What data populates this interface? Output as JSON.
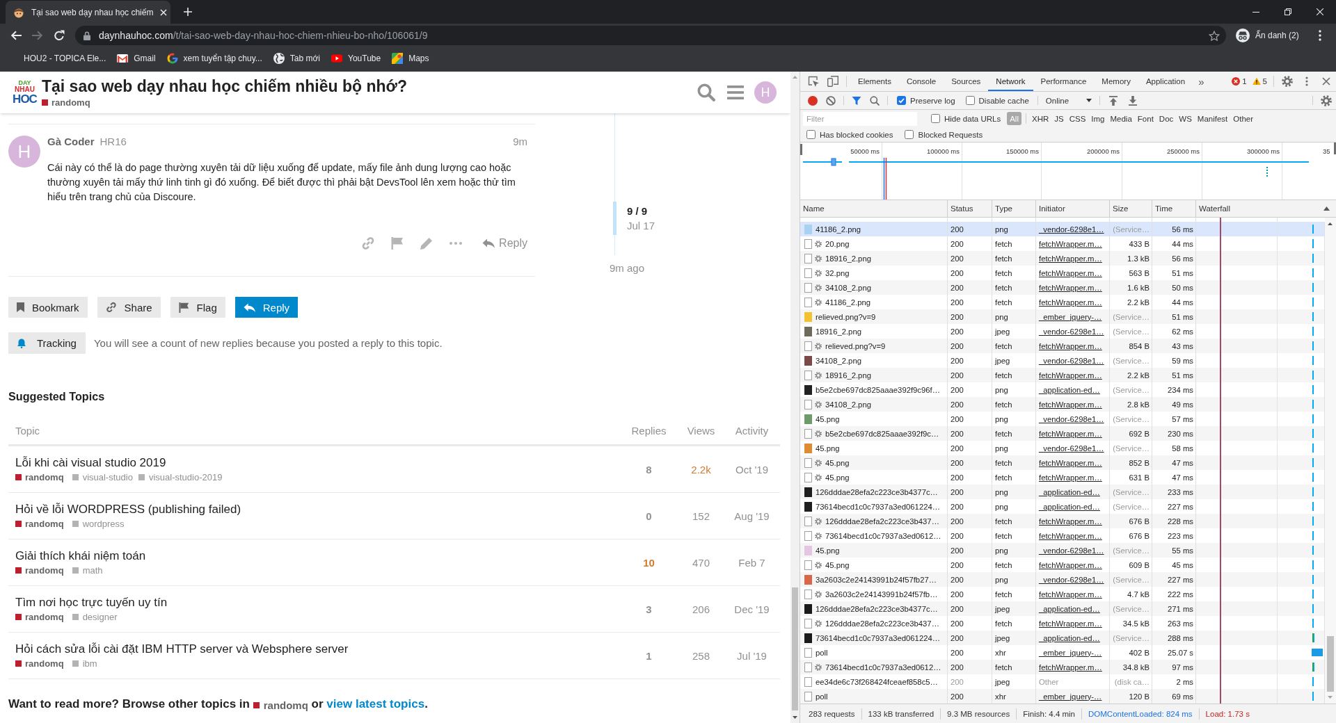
{
  "browser": {
    "tabs": [
      {
        "title": "Tại sao web dạy nhau học chiếm",
        "selected": true
      }
    ],
    "nav": [
      {
        "kind": "back",
        "disabled": false
      },
      {
        "kind": "forward",
        "disabled": true
      },
      {
        "kind": "reload",
        "disabled": false
      }
    ],
    "address": {
      "domain": "daynhauhoc.com",
      "path": "/t/tai-sao-web-day-nhau-hoc-chiem-nhieu-bo-nho/106061/9"
    },
    "profile": "Ẩn danh (2)",
    "bookmarks": [
      {
        "label": "HOU2 - TOPICA Ele...",
        "kind": "plain"
      },
      {
        "label": "Gmail",
        "kind": "mail"
      },
      {
        "label": "xem tuyển tập chuy...",
        "kind": "ring"
      },
      {
        "label": "Tab mới",
        "kind": "globe"
      },
      {
        "label": "YouTube",
        "kind": "play"
      },
      {
        "label": "Maps",
        "kind": "map"
      }
    ]
  },
  "page": {
    "header": {
      "logo": [
        "DAY",
        "NHAU",
        "HOC"
      ],
      "title": "Tại sao web dạy nhau học chiếm nhiều bộ nhớ?",
      "category": "randomq",
      "avatar": "H"
    },
    "post": {
      "avatar": "H",
      "author": "Gà Coder",
      "username": "HR16",
      "age": "9m",
      "body": "Cái này có thể là do page thường xuyên tải dữ liệu xuống để update, mấy file ảnh dung lượng cao hoặc thường xuyên tải mấy thứ linh tinh gì đó xuống. Để biết được thì phải bật DevsTool lên xem hoặc thử tìm hiểu trên trang chủ của Discoure.",
      "reply": "Reply"
    },
    "timeline": {
      "position": "9 / 9",
      "date": "Jul 17",
      "ago": "9m ago"
    },
    "actions": [
      {
        "label": "Bookmark",
        "kind": "bookmark",
        "primary": false
      },
      {
        "label": "Share",
        "kind": "share",
        "primary": false
      },
      {
        "label": "Flag",
        "kind": "flag",
        "primary": false
      },
      {
        "label": "Reply",
        "kind": "reply",
        "primary": true
      }
    ],
    "notification": {
      "label": "Tracking",
      "text": "You will see a count of new replies because you posted a reply to this topic."
    },
    "suggested": {
      "title": "Suggested Topics",
      "columns": [
        "Topic",
        "Replies",
        "Views",
        "Activity"
      ],
      "topics": [
        {
          "title": "Lỗi khi cài visual studio 2019",
          "category": "randomq",
          "tags": [
            "visual-studio",
            "visual-studio-2019"
          ],
          "replies": "8",
          "replies_hot": false,
          "views": "2.2k",
          "views_hot": true,
          "activity": "Oct '19"
        },
        {
          "title": "Hỏi về lỗi WORDPRESS (publishing failed)",
          "category": "randomq",
          "tags": [
            "wordpress"
          ],
          "replies": "0",
          "replies_hot": false,
          "views": "152",
          "views_hot": false,
          "activity": "Aug '19"
        },
        {
          "title": "Giải thích khái niệm toán",
          "category": "randomq",
          "tags": [
            "math"
          ],
          "replies": "10",
          "replies_hot": true,
          "views": "470",
          "views_hot": false,
          "activity": "Feb 7"
        },
        {
          "title": "Tìm nơi học trực tuyến uy tín",
          "category": "randomq",
          "tags": [
            "designer"
          ],
          "replies": "3",
          "replies_hot": false,
          "views": "206",
          "views_hot": false,
          "activity": "Dec '19"
        },
        {
          "title": "Hỏi cách sửa lỗi cài đặt IBM HTTP server và Websphere server",
          "category": "randomq",
          "tags": [
            "ibm"
          ],
          "replies": "1",
          "replies_hot": false,
          "views": "258",
          "views_hot": false,
          "activity": "Jul '19"
        }
      ]
    },
    "read_more": {
      "before": "Want to read more? Browse other topics in",
      "category": "randomq",
      "middle": "or",
      "link": "view latest topics",
      "after": "."
    }
  },
  "devtools": {
    "tabs": [
      {
        "label": "Elements",
        "selected": false
      },
      {
        "label": "Console",
        "selected": false
      },
      {
        "label": "Sources",
        "selected": false
      },
      {
        "label": "Network",
        "selected": true
      },
      {
        "label": "Performance",
        "selected": false
      },
      {
        "label": "Memory",
        "selected": false
      },
      {
        "label": "Application",
        "selected": false
      }
    ],
    "more": "»",
    "errors": "1",
    "warnings": "5",
    "recording": true,
    "preserve_log": {
      "label": "Preserve log",
      "checked": true
    },
    "disable_cache": {
      "label": "Disable cache",
      "checked": false
    },
    "throttling": "Online",
    "filter": {
      "placeholder": "Filter"
    },
    "hide_data_urls": {
      "label": "Hide data URLs",
      "checked": false
    },
    "types": [
      {
        "label": "All",
        "selected": true
      },
      {
        "label": "XHR",
        "selected": false
      },
      {
        "label": "JS",
        "selected": false
      },
      {
        "label": "CSS",
        "selected": false
      },
      {
        "label": "Img",
        "selected": false
      },
      {
        "label": "Media",
        "selected": false
      },
      {
        "label": "Font",
        "selected": false
      },
      {
        "label": "Doc",
        "selected": false
      },
      {
        "label": "WS",
        "selected": false
      },
      {
        "label": "Manifest",
        "selected": false
      },
      {
        "label": "Other",
        "selected": false
      }
    ],
    "blocked": [
      {
        "label": "Has blocked cookies",
        "checked": false
      },
      {
        "label": "Blocked Requests",
        "checked": false
      }
    ],
    "overview": {
      "ticks": [
        "50000 ms",
        "100000 ms",
        "150000 ms",
        "200000 ms",
        "250000 ms",
        "300000 ms",
        "35"
      ]
    },
    "columns": [
      "Name",
      "Status",
      "Type",
      "Initiator",
      "Size",
      "Time",
      "Waterfall"
    ],
    "rows": [
      {
        "name": "41186_2.png",
        "status": "200",
        "type": "png",
        "initiator": "_vendor-6298e1…",
        "size": "(Service…",
        "time": "56 ms",
        "kind": "image",
        "color": "#a9d2f2",
        "gear": false,
        "cached": true,
        "from_disk": false,
        "long": false,
        "waiting": false,
        "selected": true
      },
      {
        "name": "20.png",
        "status": "200",
        "type": "fetch",
        "initiator": "fetchWrapper.m…",
        "size": "433 B",
        "time": "44 ms",
        "kind": "document",
        "gear": true,
        "cached": false,
        "from_disk": false,
        "long": false,
        "waiting": false,
        "selected": false
      },
      {
        "name": "18916_2.png",
        "status": "200",
        "type": "fetch",
        "initiator": "fetchWrapper.m…",
        "size": "1.3 kB",
        "time": "56 ms",
        "kind": "document",
        "gear": true,
        "cached": false,
        "from_disk": false,
        "long": false,
        "waiting": false,
        "selected": false
      },
      {
        "name": "32.png",
        "status": "200",
        "type": "fetch",
        "initiator": "fetchWrapper.m…",
        "size": "563 B",
        "time": "51 ms",
        "kind": "document",
        "gear": true,
        "cached": false,
        "from_disk": false,
        "long": false,
        "waiting": false,
        "selected": false
      },
      {
        "name": "34108_2.png",
        "status": "200",
        "type": "fetch",
        "initiator": "fetchWrapper.m…",
        "size": "1.6 kB",
        "time": "50 ms",
        "kind": "document",
        "gear": true,
        "cached": false,
        "from_disk": false,
        "long": false,
        "waiting": false,
        "selected": false
      },
      {
        "name": "41186_2.png",
        "status": "200",
        "type": "fetch",
        "initiator": "fetchWrapper.m…",
        "size": "2.2 kB",
        "time": "44 ms",
        "kind": "document",
        "gear": true,
        "cached": false,
        "from_disk": false,
        "long": false,
        "waiting": false,
        "selected": false
      },
      {
        "name": "relieved.png?v=9",
        "status": "200",
        "type": "png",
        "initiator": "_ember_jquery-…",
        "size": "(Service…",
        "time": "51 ms",
        "kind": "image",
        "color": "#f2c230",
        "gear": false,
        "cached": true,
        "from_disk": false,
        "long": false,
        "waiting": false,
        "selected": false
      },
      {
        "name": "18916_2.png",
        "status": "200",
        "type": "jpeg",
        "initiator": "_vendor-6298e1…",
        "size": "(Service…",
        "time": "62 ms",
        "kind": "image",
        "color": "#6e6a5c",
        "gear": false,
        "cached": true,
        "from_disk": false,
        "long": false,
        "waiting": false,
        "selected": false
      },
      {
        "name": "relieved.png?v=9",
        "status": "200",
        "type": "fetch",
        "initiator": "fetchWrapper.m…",
        "size": "854 B",
        "time": "43 ms",
        "kind": "document",
        "gear": true,
        "cached": false,
        "from_disk": false,
        "long": false,
        "waiting": false,
        "selected": false
      },
      {
        "name": "34108_2.png",
        "status": "200",
        "type": "jpeg",
        "initiator": "_vendor-6298e1…",
        "size": "(Service…",
        "time": "59 ms",
        "kind": "image",
        "color": "#7b4a48",
        "gear": false,
        "cached": true,
        "from_disk": false,
        "long": false,
        "waiting": false,
        "selected": false
      },
      {
        "name": "18916_2.png",
        "status": "200",
        "type": "fetch",
        "initiator": "fetchWrapper.m…",
        "size": "2.2 kB",
        "time": "51 ms",
        "kind": "document",
        "gear": true,
        "cached": false,
        "from_disk": false,
        "long": false,
        "waiting": false,
        "selected": false
      },
      {
        "name": "b5e2cbe697dc825aaae392f9c96f…",
        "status": "200",
        "type": "png",
        "initiator": "_application-ed…",
        "size": "(Service…",
        "time": "234 ms",
        "kind": "image",
        "color": "#222222",
        "gear": false,
        "cached": true,
        "from_disk": false,
        "long": false,
        "waiting": false,
        "selected": false
      },
      {
        "name": "34108_2.png",
        "status": "200",
        "type": "fetch",
        "initiator": "fetchWrapper.m…",
        "size": "2.8 kB",
        "time": "49 ms",
        "kind": "document",
        "gear": true,
        "cached": false,
        "from_disk": false,
        "long": false,
        "waiting": false,
        "selected": false
      },
      {
        "name": "45.png",
        "status": "200",
        "type": "png",
        "initiator": "_vendor-6298e1…",
        "size": "(Service…",
        "time": "57 ms",
        "kind": "image",
        "color": "#6d9c6a",
        "gear": false,
        "cached": true,
        "from_disk": false,
        "long": false,
        "waiting": false,
        "selected": false
      },
      {
        "name": "b5e2cbe697dc825aaae392f9c…",
        "status": "200",
        "type": "fetch",
        "initiator": "fetchWrapper.m…",
        "size": "692 B",
        "time": "230 ms",
        "kind": "document",
        "gear": true,
        "cached": false,
        "from_disk": false,
        "long": false,
        "waiting": false,
        "selected": false
      },
      {
        "name": "45.png",
        "status": "200",
        "type": "png",
        "initiator": "_vendor-6298e1…",
        "size": "(Service…",
        "time": "58 ms",
        "kind": "image",
        "color": "#e08b2f",
        "gear": false,
        "cached": true,
        "from_disk": false,
        "long": false,
        "waiting": false,
        "selected": false
      },
      {
        "name": "45.png",
        "status": "200",
        "type": "fetch",
        "initiator": "fetchWrapper.m…",
        "size": "852 B",
        "time": "47 ms",
        "kind": "document",
        "gear": true,
        "cached": false,
        "from_disk": false,
        "long": false,
        "waiting": false,
        "selected": false
      },
      {
        "name": "45.png",
        "status": "200",
        "type": "fetch",
        "initiator": "fetchWrapper.m…",
        "size": "631 B",
        "time": "47 ms",
        "kind": "document",
        "gear": true,
        "cached": false,
        "from_disk": false,
        "long": false,
        "waiting": false,
        "selected": false
      },
      {
        "name": "126dddae28efa2c223ce3b4377c…",
        "status": "200",
        "type": "png",
        "initiator": "_application-ed…",
        "size": "(Service…",
        "time": "233 ms",
        "kind": "image",
        "color": "#1f1f1f",
        "gear": false,
        "cached": true,
        "from_disk": false,
        "long": false,
        "waiting": false,
        "selected": false
      },
      {
        "name": "73614becd1c0c7937a3ed061224…",
        "status": "200",
        "type": "png",
        "initiator": "_application-ed…",
        "size": "(Service…",
        "time": "227 ms",
        "kind": "image",
        "color": "#1f1f1f",
        "gear": false,
        "cached": true,
        "from_disk": false,
        "long": false,
        "waiting": false,
        "selected": false
      },
      {
        "name": "126dddae28efa2c223ce3b437…",
        "status": "200",
        "type": "fetch",
        "initiator": "fetchWrapper.m…",
        "size": "676 B",
        "time": "228 ms",
        "kind": "document",
        "gear": true,
        "cached": false,
        "from_disk": false,
        "long": false,
        "waiting": false,
        "selected": false
      },
      {
        "name": "73614becd1c0c7937a3ed0612…",
        "status": "200",
        "type": "fetch",
        "initiator": "fetchWrapper.m…",
        "size": "676 B",
        "time": "223 ms",
        "kind": "document",
        "gear": true,
        "cached": false,
        "from_disk": false,
        "long": false,
        "waiting": false,
        "selected": false
      },
      {
        "name": "45.png",
        "status": "200",
        "type": "png",
        "initiator": "_vendor-6298e1…",
        "size": "(Service…",
        "time": "55 ms",
        "kind": "image",
        "color": "#e5c6e0",
        "gear": false,
        "cached": true,
        "from_disk": false,
        "long": false,
        "waiting": false,
        "selected": false
      },
      {
        "name": "45.png",
        "status": "200",
        "type": "fetch",
        "initiator": "fetchWrapper.m…",
        "size": "609 B",
        "time": "45 ms",
        "kind": "document",
        "gear": true,
        "cached": false,
        "from_disk": false,
        "long": false,
        "waiting": false,
        "selected": false
      },
      {
        "name": "3a2603c2e24143991b24f57fb27…",
        "status": "200",
        "type": "png",
        "initiator": "_vendor-6298e1…",
        "size": "(Service…",
        "time": "227 ms",
        "kind": "image",
        "color": "#d8674a",
        "gear": false,
        "cached": true,
        "from_disk": false,
        "long": false,
        "waiting": false,
        "selected": false
      },
      {
        "name": "3a2603c2e24143991b24f57fb…",
        "status": "200",
        "type": "fetch",
        "initiator": "fetchWrapper.m…",
        "size": "4.7 kB",
        "time": "222 ms",
        "kind": "document",
        "gear": true,
        "cached": false,
        "from_disk": false,
        "long": false,
        "waiting": false,
        "selected": false
      },
      {
        "name": "126dddae28efa2c223ce3b4377c…",
        "status": "200",
        "type": "jpeg",
        "initiator": "_application-ed…",
        "size": "(Service…",
        "time": "271 ms",
        "kind": "image",
        "color": "#1a1a1a",
        "gear": false,
        "cached": true,
        "from_disk": false,
        "long": false,
        "waiting": false,
        "selected": false
      },
      {
        "name": "126dddae28efa2c223ce3b437…",
        "status": "200",
        "type": "fetch",
        "initiator": "fetchWrapper.m…",
        "size": "34.5 kB",
        "time": "263 ms",
        "kind": "document",
        "gear": true,
        "cached": false,
        "from_disk": false,
        "long": false,
        "waiting": false,
        "selected": false
      },
      {
        "name": "73614becd1c0c7937a3ed061224…",
        "status": "200",
        "type": "jpeg",
        "initiator": "_application-ed…",
        "size": "(Service…",
        "time": "288 ms",
        "kind": "image",
        "color": "#1a1a1a",
        "gear": false,
        "cached": true,
        "from_disk": false,
        "long": false,
        "waiting": true,
        "selected": false
      },
      {
        "name": "poll",
        "status": "200",
        "type": "xhr",
        "initiator": "_ember_jquery-…",
        "size": "402 B",
        "time": "25.07 s",
        "kind": "document",
        "gear": false,
        "cached": false,
        "from_disk": false,
        "long": true,
        "waiting": false,
        "selected": false
      },
      {
        "name": "73614becd1c0c7937a3ed0612…",
        "status": "200",
        "type": "fetch",
        "initiator": "fetchWrapper.m…",
        "size": "34.8 kB",
        "time": "97 ms",
        "kind": "document",
        "gear": true,
        "cached": false,
        "from_disk": false,
        "long": false,
        "waiting": true,
        "selected": false
      },
      {
        "name": "ee34de6c73f268424fceaef858c5…",
        "status": "200",
        "type": "jpeg",
        "initiator": "Other",
        "size": "(disk ca…",
        "time": "2 ms",
        "kind": "document",
        "gear": false,
        "cached": true,
        "from_disk": true,
        "long": false,
        "waiting": false,
        "selected": false
      },
      {
        "name": "poll",
        "status": "200",
        "type": "xhr",
        "initiator": "_ember_jquery-…",
        "size": "120 B",
        "time": "69 ms",
        "kind": "document",
        "gear": false,
        "cached": false,
        "from_disk": false,
        "long": false,
        "waiting": false,
        "selected": false
      }
    ],
    "summary": [
      {
        "text": "283 requests",
        "color": "#333333"
      },
      {
        "text": "133 kB transferred",
        "color": "#333333"
      },
      {
        "text": "9.3 MB resources",
        "color": "#333333"
      },
      {
        "text": "Finish: 4.4 min",
        "color": "#333333"
      },
      {
        "text": "DOMContentLoaded: 824 ms",
        "color": "#1a73e8"
      },
      {
        "text": "Load: 1.73 s",
        "color": "#c5221f"
      }
    ]
  }
}
